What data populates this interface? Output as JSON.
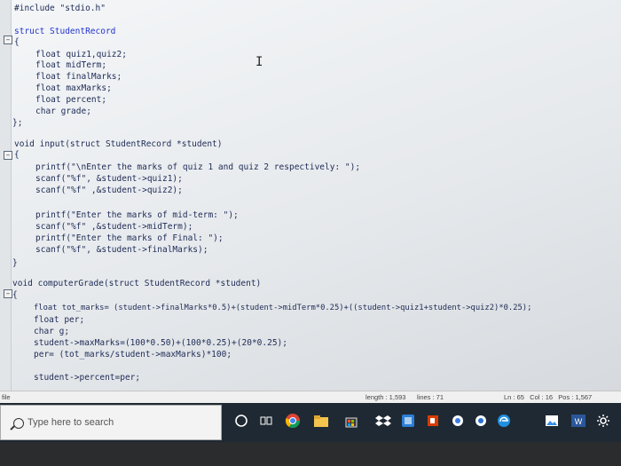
{
  "editor": {
    "lines": [
      {
        "text": "#include \"stdio.h\""
      },
      {
        "text": "struct StudentRecord"
      },
      {
        "text": "{"
      },
      {
        "text": "float quiz1,quiz2;"
      },
      {
        "text": "float midTerm;"
      },
      {
        "text": "float finalMarks;"
      },
      {
        "text": "float maxMarks;"
      },
      {
        "text": "float percent;"
      },
      {
        "text": "char grade;"
      },
      {
        "text": "};"
      },
      {
        "text": "void input(struct StudentRecord *student)"
      },
      {
        "text": "{"
      },
      {
        "text": "printf(\"\\nEnter the marks of quiz 1 and quiz 2 respectively: \");"
      },
      {
        "text": "scanf(\"%f\", &student->quiz1);"
      },
      {
        "text": "scanf(\"%f\" ,&student->quiz2);"
      },
      {
        "text": "printf(\"Enter the marks of mid-term: \");"
      },
      {
        "text": "scanf(\"%f\" ,&student->midTerm);"
      },
      {
        "text": "printf(\"Enter the marks of Final: \");"
      },
      {
        "text": "scanf(\"%f\", &student->finalMarks);"
      },
      {
        "text": "}"
      },
      {
        "text": "void computerGrade(struct StudentRecord *student)"
      },
      {
        "text": "{"
      },
      {
        "text": "float tot_marks= (student->finalMarks*0.5)+(student->midTerm*0.25)+((student->quiz1+student->quiz2)*0.25);"
      },
      {
        "text": "float per;"
      },
      {
        "text": "char g;"
      },
      {
        "text": "student->maxMarks=(100*0.50)+(100*0.25)+(20*0.25);"
      },
      {
        "text": "per= (tot_marks/student->maxMarks)*100;"
      },
      {
        "text": "student->percent=per;"
      }
    ]
  },
  "status_bar": {
    "file_label": "file",
    "length": "length : 1,593",
    "lines": "lines : 71",
    "ln_col": "Ln : 65   Col : 16   Pos : 1,567"
  },
  "taskbar": {
    "search_placeholder": "Type here to search",
    "icons": [
      "cortana-icon",
      "task-view-icon",
      "chrome-icon",
      "folder-icon",
      "store-icon",
      "dropbox-icon",
      "app-icon",
      "office-icon",
      "circle-app-icon",
      "circle-app-icon-2",
      "edge-icon",
      "photos-icon",
      "word-icon",
      "settings-icon"
    ]
  }
}
